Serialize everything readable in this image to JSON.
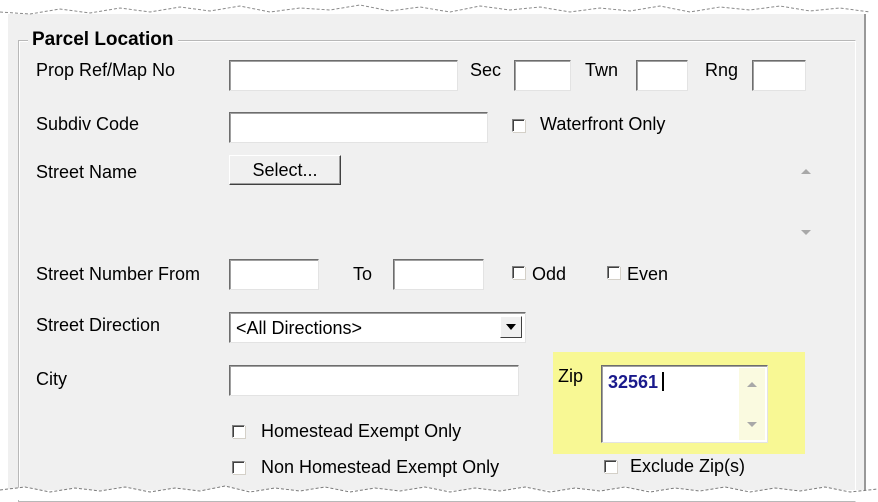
{
  "group": {
    "title": "Parcel Location"
  },
  "labels": {
    "prop_ref": "Prop Ref/Map No",
    "sec": "Sec",
    "twn": "Twn",
    "rng": "Rng",
    "subdiv": "Subdiv Code",
    "waterfront": "Waterfront Only",
    "street_name": "Street Name",
    "select_button": "Select...",
    "street_number_from": "Street Number  From",
    "to": "To",
    "odd": "Odd",
    "even": "Even",
    "street_direction": "Street Direction",
    "city": "City",
    "zip": "Zip",
    "homestead": "Homestead Exempt Only",
    "non_homestead": "Non Homestead Exempt Only",
    "exclude_zip": "Exclude Zip(s)"
  },
  "values": {
    "street_direction": "<All Directions>",
    "zip": "32561"
  },
  "colors": {
    "highlight": "#f8f88a",
    "zip_text": "#1a1a8c"
  }
}
